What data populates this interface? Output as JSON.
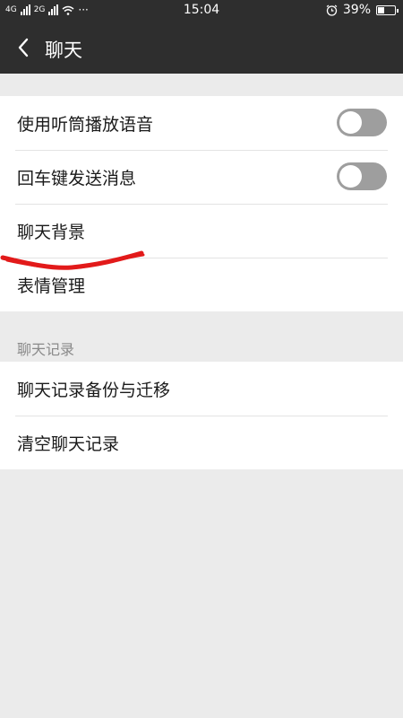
{
  "status_bar": {
    "left_indicators": [
      "4G",
      "2G"
    ],
    "more": "···",
    "time": "15:04",
    "battery": "39%",
    "battery_level": 0.39
  },
  "header": {
    "back_icon": "chevron-left-icon",
    "title": "聊天"
  },
  "settings": {
    "group1": [
      {
        "label": "使用听筒播放语音",
        "toggle": false
      },
      {
        "label": "回车键发送消息",
        "toggle": false
      },
      {
        "label": "聊天背景"
      },
      {
        "label": "表情管理"
      }
    ],
    "section2_title": "聊天记录",
    "group2": [
      {
        "label": "聊天记录备份与迁移"
      },
      {
        "label": "清空聊天记录"
      }
    ]
  },
  "colors": {
    "header_bg": "#2e2e2e",
    "page_bg": "#ebebeb",
    "toggle_off": "#9e9e9e",
    "annotation": "#e21a1a"
  }
}
